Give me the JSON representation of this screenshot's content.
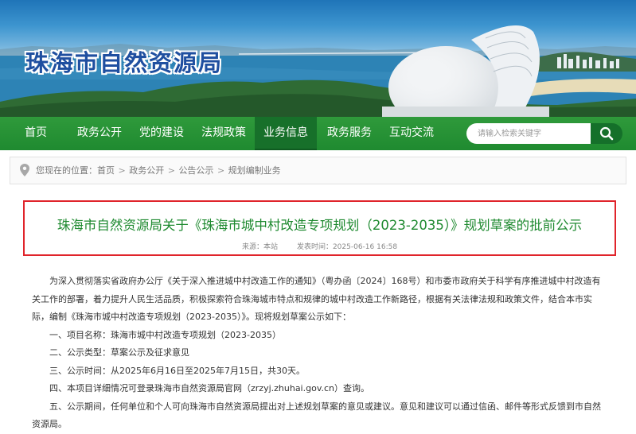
{
  "site": {
    "title": "珠海市自然资源局"
  },
  "nav": {
    "items": [
      {
        "label": "首页"
      },
      {
        "label": "政务公开"
      },
      {
        "label": "党的建设"
      },
      {
        "label": "法规政策"
      },
      {
        "label": "业务信息",
        "active": true
      },
      {
        "label": "政务服务"
      },
      {
        "label": "互动交流"
      }
    ],
    "search_placeholder": "请输入检索关键字",
    "search_icon": "search-icon"
  },
  "breadcrumb": {
    "prefix": "您现在的位置：",
    "items": [
      "首页",
      "政务公开",
      "公告公示",
      "规划编制业务"
    ],
    "separator": ">",
    "icon": "location-pin-icon"
  },
  "article": {
    "title": "珠海市自然资源局关于《珠海市城中村改造专项规划（2023-2035）》规划草案的批前公示",
    "source": "来源：本站",
    "date": "发表时间：2025-06-16  16:58",
    "paragraphs": [
      "为深入贯彻落实省政府办公厅《关于深入推进城中村改造工作的通知》（粤办函〔2024〕168号）和市委市政府关于科学有序推进城中村改造有关工作的部署，着力提升人民生活品质，积极探索符合珠海城市特点和规律的城中村改造工作新路径，根据有关法律法规和政策文件，结合本市实际，编制《珠海市城中村改造专项规划（2023-2035）》。现将规划草案公示如下：",
      "一、项目名称：珠海市城中村改造专项规划（2023-2035）",
      "二、公示类型：草案公示及征求意见",
      "三、公示时间：从2025年6月16日至2025年7月15日，共30天。",
      "四、本项目详细情况可登录珠海市自然资源局官网（zrzyj.zhuhai.gov.cn）查询。",
      "五、公示期间，任何单位和个人可向珠海市自然资源局提出对上述规划草案的意见或建议。意见和建议可以通过信函、邮件等形式反馈到市自然资源局。"
    ]
  },
  "colors": {
    "nav_green": "#1f8a30",
    "nav_active": "#17702a",
    "title_green": "#1f8a30",
    "highlight_red": "#e0242b",
    "site_title_blue": "#1f4fa0"
  }
}
